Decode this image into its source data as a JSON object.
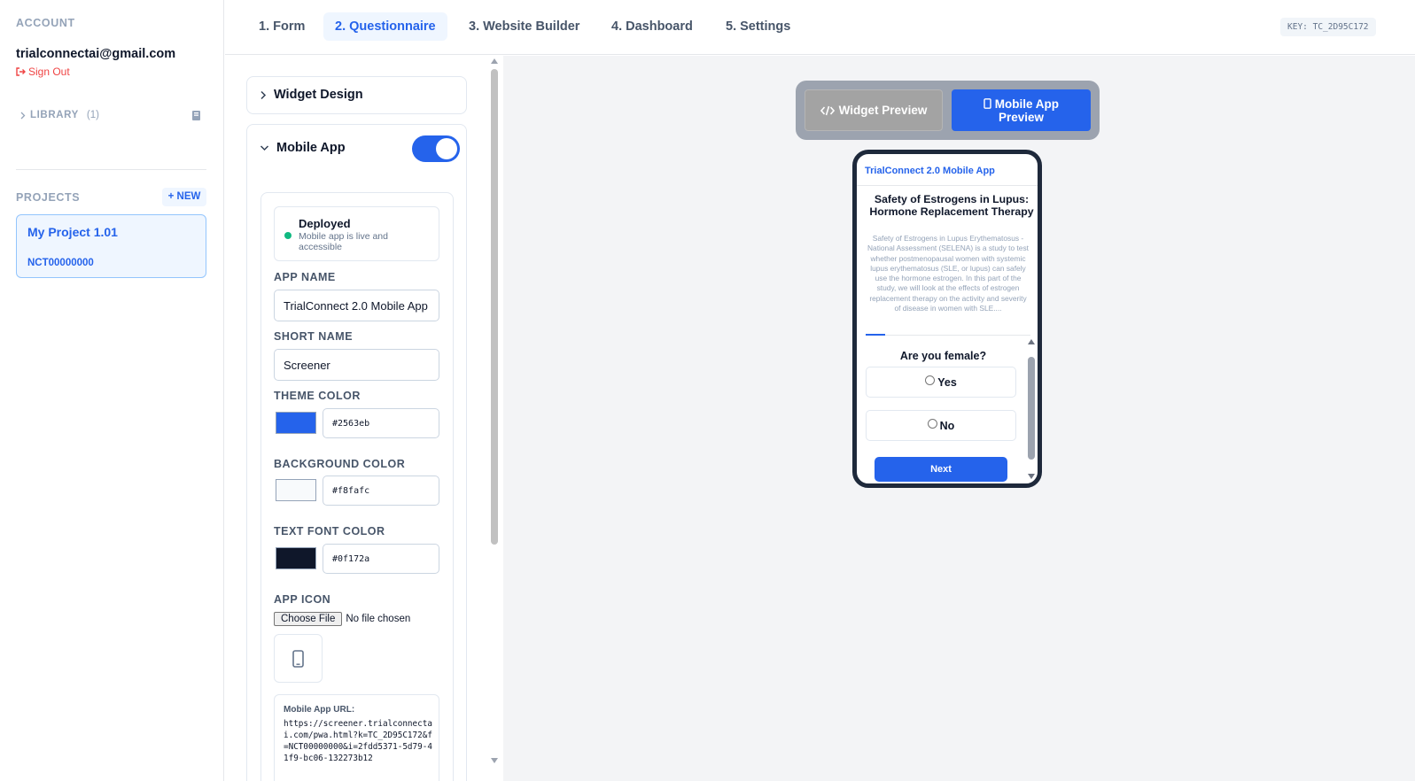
{
  "sidebar": {
    "account_label": "ACCOUNT",
    "email": "trialconnectai@gmail.com",
    "sign_out": "Sign Out",
    "library_label": "LIBRARY",
    "library_count": "(1)",
    "projects_label": "PROJECTS",
    "new_button": "+ NEW",
    "project": {
      "name": "My Project 1.01",
      "id": "NCT00000000"
    }
  },
  "nav": {
    "tabs": [
      {
        "label": "1. Form"
      },
      {
        "label": "2. Questionnaire"
      },
      {
        "label": "3. Website Builder"
      },
      {
        "label": "4. Dashboard"
      },
      {
        "label": "5. Settings"
      }
    ],
    "active_tab": "2. Questionnaire",
    "key": "KEY: TC_2D95C172"
  },
  "panel": {
    "widget_design": "Widget Design",
    "mobile_app": "Mobile App",
    "mobile_app_enabled": true,
    "deployed_title": "Deployed",
    "deployed_desc": "Mobile app is live and accessible",
    "app_name_label": "APP NAME",
    "app_name_value": "TrialConnect 2.0 Mobile App",
    "short_name_label": "SHORT NAME",
    "short_name_value": "Screener",
    "theme_color_label": "THEME COLOR",
    "theme_color": "#2563eb",
    "background_color_label": "BACKGROUND COLOR",
    "background_color": "#f8fafc",
    "text_color_label": "TEXT FONT COLOR",
    "text_color": "#0f172a",
    "app_icon_label": "APP ICON",
    "choose_file": "Choose File",
    "no_file": "No file chosen",
    "url_label": "Mobile App URL:",
    "url_value": "https://screener.trialconnectai.com/pwa.html?k=TC_2D95C172&f=NCT00000000&i=2fdd5371-5d79-41f9-bc06-132273b12"
  },
  "preview": {
    "widget_preview": "Widget Preview",
    "mobile_preview": "Mobile App Preview",
    "app_title": "TrialConnect 2.0 Mobile App",
    "study_title": "Safety of Estrogens in Lupus: Hormone Replacement Therapy",
    "study_desc": "Safety of Estrogens in Lupus Erythematosus - National Assessment (SELENA) is a study to test whether postmenopausal women with systemic lupus erythematosus (SLE, or lupus) can safely use the hormone estrogen. In this part of the study, we will look at the effects of estrogen replacement therapy on the activity and severity of disease in women with SLE....",
    "question": "Are you female?",
    "options": [
      "Yes",
      "No"
    ],
    "next": "Next",
    "progress_fraction": 0.12
  }
}
